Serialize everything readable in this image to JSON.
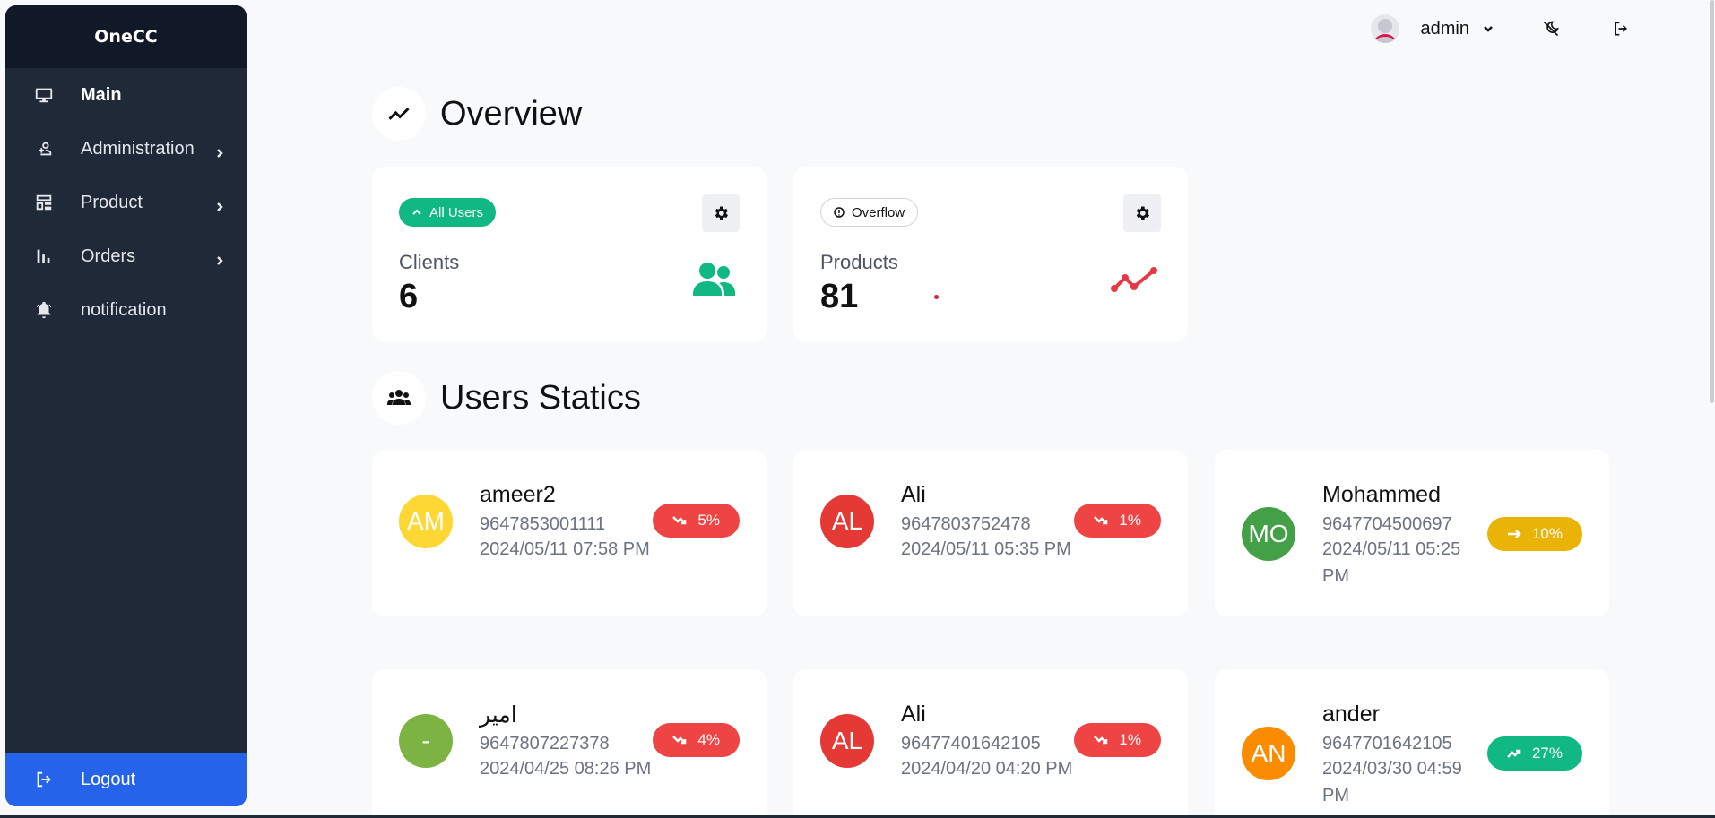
{
  "sidebar": {
    "brand": "OneCC",
    "items": [
      {
        "label": "Main",
        "icon": "monitor-icon"
      },
      {
        "label": "Administration",
        "icon": "user-add-icon"
      },
      {
        "label": "Product",
        "icon": "product-icon"
      },
      {
        "label": "Orders",
        "icon": "bar-chart-icon"
      },
      {
        "label": "notification",
        "icon": "bell-icon"
      }
    ],
    "logout": "Logout"
  },
  "topbar": {
    "user": "admin"
  },
  "overview": {
    "title": "Overview",
    "cards": [
      {
        "badge": "All Users",
        "label": "Clients",
        "value": "6"
      },
      {
        "badge": "Overflow",
        "label": "Products",
        "value": "81"
      }
    ]
  },
  "users_statics": {
    "title": "Users Statics",
    "users": [
      {
        "initials": "AM",
        "name": "ameer2",
        "phone": "9647853001111",
        "date": "2024/05/11 07:58 PM",
        "trend": "5%",
        "trend_dir": "down",
        "avatar_color": "#fdd835"
      },
      {
        "initials": "AL",
        "name": "Ali",
        "phone": "9647803752478",
        "date": "2024/05/11 05:35 PM",
        "trend": "1%",
        "trend_dir": "down",
        "avatar_color": "#e53935"
      },
      {
        "initials": "MO",
        "name": "Mohammed",
        "phone": "9647704500697",
        "date": "2024/05/11 05:25 PM",
        "trend": "10%",
        "trend_dir": "flat",
        "avatar_color": "#43a047"
      },
      {
        "initials": "-",
        "name": "امير",
        "phone": "9647807227378",
        "date": "2024/04/25 08:26 PM",
        "trend": "4%",
        "trend_dir": "down",
        "avatar_color": "#7cb342"
      },
      {
        "initials": "AL",
        "name": "Ali",
        "phone": "96477401642105",
        "date": "2024/04/20 04:20 PM",
        "trend": "1%",
        "trend_dir": "down",
        "avatar_color": "#e53935"
      },
      {
        "initials": "AN",
        "name": "ander",
        "phone": "9647701642105",
        "date": "2024/03/30 04:59 PM",
        "trend": "27%",
        "trend_dir": "up",
        "avatar_color": "#fb8c00"
      }
    ]
  }
}
